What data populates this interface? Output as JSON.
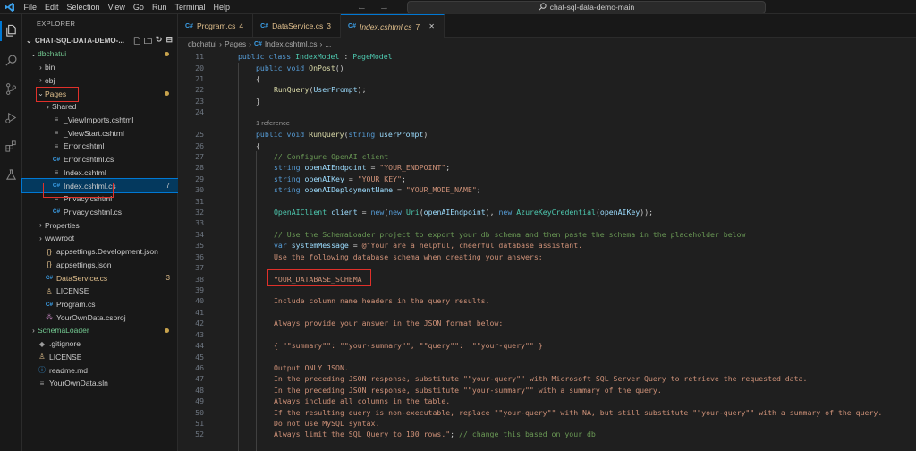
{
  "titlebar": {
    "menu": [
      "File",
      "Edit",
      "Selection",
      "View",
      "Go",
      "Run",
      "Terminal",
      "Help"
    ],
    "search_text": "chat-sql-data-demo-main"
  },
  "sidebar": {
    "header": "EXPLORER",
    "workspace": "CHAT-SQL-DATA-DEMO-...",
    "tree": [
      {
        "label": "dbchatui",
        "depth": 0,
        "kind": "folder-open",
        "color": "#73c991",
        "dot": true
      },
      {
        "label": "bin",
        "depth": 1,
        "kind": "folder"
      },
      {
        "label": "obj",
        "depth": 1,
        "kind": "folder"
      },
      {
        "label": "Pages",
        "depth": 1,
        "kind": "folder-open",
        "color": "#e2c08d",
        "dot": true,
        "highlight": true
      },
      {
        "label": "Shared",
        "depth": 2,
        "kind": "folder"
      },
      {
        "label": "_ViewImports.cshtml",
        "depth": 2,
        "kind": "file",
        "icon": "≡"
      },
      {
        "label": "_ViewStart.cshtml",
        "depth": 2,
        "kind": "file",
        "icon": "≡"
      },
      {
        "label": "Error.cshtml",
        "depth": 2,
        "kind": "file",
        "icon": "≡"
      },
      {
        "label": "Error.cshtml.cs",
        "depth": 2,
        "kind": "file",
        "icon": "C#"
      },
      {
        "label": "Index.cshtml",
        "depth": 2,
        "kind": "file",
        "icon": "≡"
      },
      {
        "label": "Index.cshtml.cs",
        "depth": 2,
        "kind": "file",
        "icon": "C#",
        "badge": "7",
        "selected": true,
        "highlight": true
      },
      {
        "label": "Privacy.cshtml",
        "depth": 2,
        "kind": "file",
        "icon": "≡"
      },
      {
        "label": "Privacy.cshtml.cs",
        "depth": 2,
        "kind": "file",
        "icon": "C#"
      },
      {
        "label": "Properties",
        "depth": 1,
        "kind": "folder"
      },
      {
        "label": "wwwroot",
        "depth": 1,
        "kind": "folder"
      },
      {
        "label": "appsettings.Development.json",
        "depth": 1,
        "kind": "file",
        "icon": "{}"
      },
      {
        "label": "appsettings.json",
        "depth": 1,
        "kind": "file",
        "icon": "{}"
      },
      {
        "label": "DataService.cs",
        "depth": 1,
        "kind": "file",
        "icon": "C#",
        "badge": "3",
        "color": "#e2c08d"
      },
      {
        "label": "LICENSE",
        "depth": 1,
        "kind": "file",
        "icon": "♙"
      },
      {
        "label": "Program.cs",
        "depth": 1,
        "kind": "file",
        "icon": "C#"
      },
      {
        "label": "YourOwnData.csproj",
        "depth": 1,
        "kind": "file",
        "icon": "⁂"
      },
      {
        "label": "SchemaLoader",
        "depth": 0,
        "kind": "folder",
        "color": "#73c991",
        "dot": true
      },
      {
        "label": ".gitignore",
        "depth": 0,
        "kind": "file",
        "icon": "◆"
      },
      {
        "label": "LICENSE",
        "depth": 0,
        "kind": "file",
        "icon": "♙"
      },
      {
        "label": "readme.md",
        "depth": 0,
        "kind": "file",
        "icon": "ⓘ"
      },
      {
        "label": "YourOwnData.sln",
        "depth": 0,
        "kind": "file",
        "icon": "≡"
      }
    ]
  },
  "tabs": [
    {
      "label": "Program.cs",
      "badge": "4"
    },
    {
      "label": "DataService.cs",
      "badge": "3"
    },
    {
      "label": "Index.cshtml.cs",
      "badge": "7",
      "active": true
    }
  ],
  "breadcrumb": [
    "dbchatui",
    "Pages",
    "Index.cshtml.cs",
    "..."
  ],
  "editor": {
    "codelens": "1 reference",
    "lines": [
      {
        "n": "11",
        "text": "public class IndexModel : PageModel",
        "indent": 0,
        "partial": true
      },
      {
        "n": "20",
        "text": "public void OnPost()",
        "indent": 1
      },
      {
        "n": "21",
        "text": "{",
        "indent": 1
      },
      {
        "n": "22",
        "text": "RunQuery(UserPrompt);",
        "indent": 2
      },
      {
        "n": "23",
        "text": "}",
        "indent": 1
      },
      {
        "n": "24",
        "text": "",
        "indent": 0
      },
      {
        "n": "",
        "text": "",
        "indent": 0,
        "lens": true
      },
      {
        "n": "25",
        "text": "public void RunQuery(string userPrompt)",
        "indent": 1
      },
      {
        "n": "26",
        "text": "{",
        "indent": 1
      },
      {
        "n": "27",
        "text": "// Configure OpenAI client",
        "indent": 2
      },
      {
        "n": "28",
        "text": "string openAIEndpoint = \"YOUR_ENDPOINT\";",
        "indent": 2
      },
      {
        "n": "29",
        "text": "string openAIKey = \"YOUR_KEY\";",
        "indent": 2
      },
      {
        "n": "30",
        "text": "string openAIDeploymentName = \"YOUR_MODE_NAME\";",
        "indent": 2
      },
      {
        "n": "31",
        "text": "",
        "indent": 0
      },
      {
        "n": "32",
        "text": "OpenAIClient client = new(new Uri(openAIEndpoint), new AzureKeyCredential(openAIKey));",
        "indent": 2
      },
      {
        "n": "33",
        "text": "",
        "indent": 0
      },
      {
        "n": "34",
        "text": "// Use the SchemaLoader project to export your db schema and then paste the schema in the placeholder below",
        "indent": 2
      },
      {
        "n": "35",
        "text": "var systemMessage = @\"Your are a helpful, cheerful database assistant.",
        "indent": 2
      },
      {
        "n": "36",
        "text": "Use the following database schema when creating your answers:",
        "indent": 2
      },
      {
        "n": "37",
        "text": "",
        "indent": 0
      },
      {
        "n": "38",
        "text": "YOUR_DATABASE_SCHEMA",
        "indent": 2,
        "highlight": true
      },
      {
        "n": "39",
        "text": "",
        "indent": 0
      },
      {
        "n": "40",
        "text": "Include column name headers in the query results.",
        "indent": 2
      },
      {
        "n": "41",
        "text": "",
        "indent": 0
      },
      {
        "n": "42",
        "text": "Always provide your answer in the JSON format below:",
        "indent": 2
      },
      {
        "n": "43",
        "text": "",
        "indent": 0
      },
      {
        "n": "44",
        "text": "{ \"\"summary\"\": \"\"your-summary\"\", \"\"query\"\":  \"\"your-query\"\" }",
        "indent": 2
      },
      {
        "n": "45",
        "text": "",
        "indent": 0
      },
      {
        "n": "46",
        "text": "Output ONLY JSON.",
        "indent": 2
      },
      {
        "n": "47",
        "text": "In the preceding JSON response, substitute \"\"your-query\"\" with Microsoft SQL Server Query to retrieve the requested data.",
        "indent": 2
      },
      {
        "n": "48",
        "text": "In the preceding JSON response, substitute \"\"your-summary\"\" with a summary of the query.",
        "indent": 2
      },
      {
        "n": "49",
        "text": "Always include all columns in the table.",
        "indent": 2
      },
      {
        "n": "50",
        "text": "If the resulting query is non-executable, replace \"\"your-query\"\" with NA, but still substitute \"\"your-query\"\" with a summary of the query.",
        "indent": 2
      },
      {
        "n": "51",
        "text": "Do not use MySQL syntax.",
        "indent": 2
      },
      {
        "n": "52",
        "text": "Always limit the SQL Query to 100 rows.\"; // change this based on your db",
        "indent": 2
      }
    ]
  },
  "colors": {
    "keyword": "#569cd6",
    "type": "#4ec9b0",
    "method": "#dcdcaa",
    "string": "#ce9178",
    "comment": "#6a9955",
    "variable": "#9cdcfe",
    "control": "#c586c0",
    "highlight_box": "#e0302a"
  }
}
